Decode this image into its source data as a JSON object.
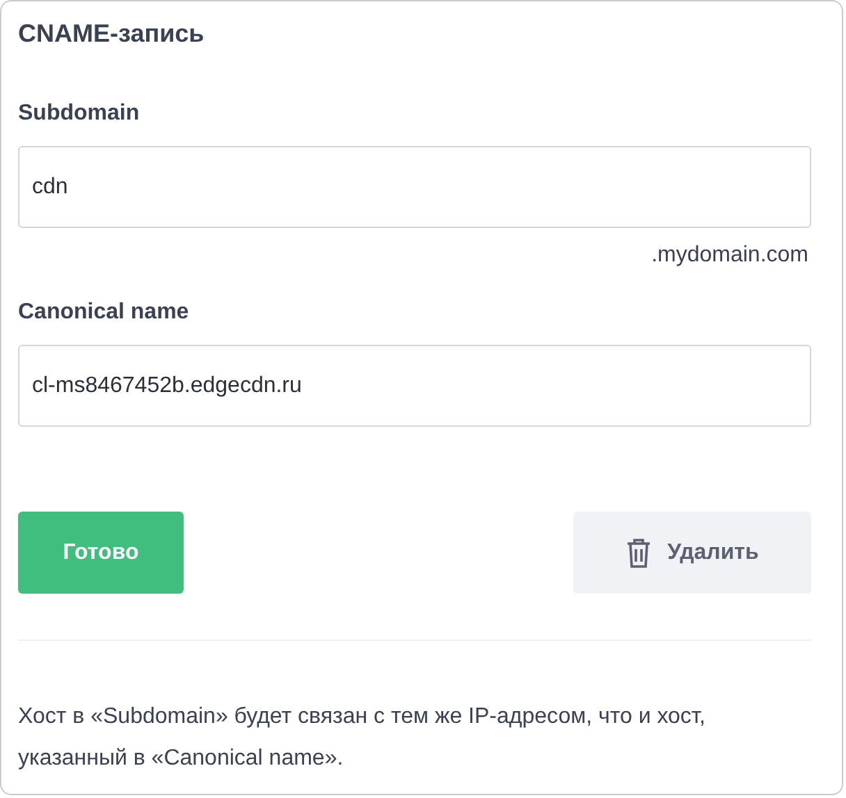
{
  "title": "CNAME-запись",
  "fields": [
    {
      "label": "Subdomain",
      "value": "cdn",
      "suffix": ".mydomain.com"
    },
    {
      "label": "Canonical name",
      "value": "cl-ms8467452b.edgecdn.ru"
    }
  ],
  "buttons": [
    {
      "kind": "primary",
      "label": "Готово"
    },
    {
      "kind": "delete",
      "label": "Удалить"
    }
  ],
  "note": "Хост в «Subdomain» будет связан с тем же IP-адресом, что и хост, указанный в «Canonical name»."
}
